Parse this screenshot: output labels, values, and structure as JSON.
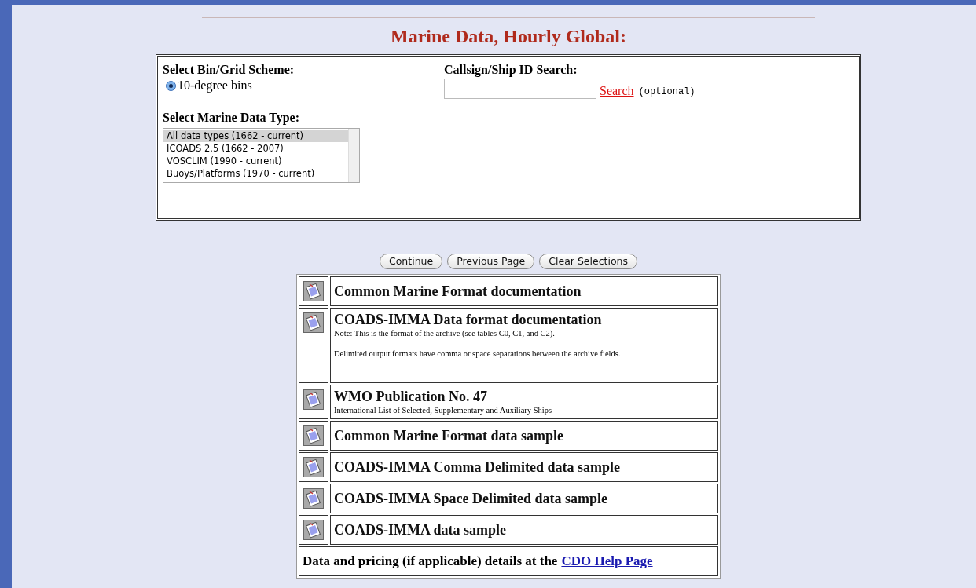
{
  "title": "Marine Data, Hourly Global:",
  "bin_scheme": {
    "heading": "Select Bin/Grid Scheme:",
    "options": [
      {
        "label": "10-degree bins",
        "selected": true
      }
    ]
  },
  "search": {
    "heading": "Callsign/Ship ID Search:",
    "link": "Search",
    "note": "(optional)"
  },
  "data_type": {
    "heading": "Select Marine Data Type:",
    "options": [
      {
        "label": "All data types (1662 - current)",
        "selected": true
      },
      {
        "label": "ICOADS 2.5 (1662 - 2007)",
        "selected": false
      },
      {
        "label": "VOSCLIM (1990 - current)",
        "selected": false
      },
      {
        "label": "Buoys/Platforms (1970 - current)",
        "selected": false
      }
    ]
  },
  "buttons": [
    "Continue",
    "Previous Page",
    "Clear Selections"
  ],
  "documents": [
    {
      "title": "Common Marine Format documentation"
    },
    {
      "title": "COADS-IMMA Data format documentation",
      "notes": [
        "Note: This is the format of the archive (see tables C0, C1, and C2).",
        "Delimited output formats have comma or space separations between the archive fields."
      ]
    },
    {
      "title": "WMO Publication No. 47",
      "notes": [
        "International List of Selected, Supplementary and Auxiliary Ships"
      ]
    },
    {
      "title": "Common Marine Format data sample"
    },
    {
      "title": "COADS-IMMA Comma Delimited data sample"
    },
    {
      "title": "COADS-IMMA Space Delimited data sample"
    },
    {
      "title": "COADS-IMMA data sample"
    }
  ],
  "footer": {
    "text": "Data and pricing (if applicable) details at the",
    "link": "CDO Help Page"
  }
}
